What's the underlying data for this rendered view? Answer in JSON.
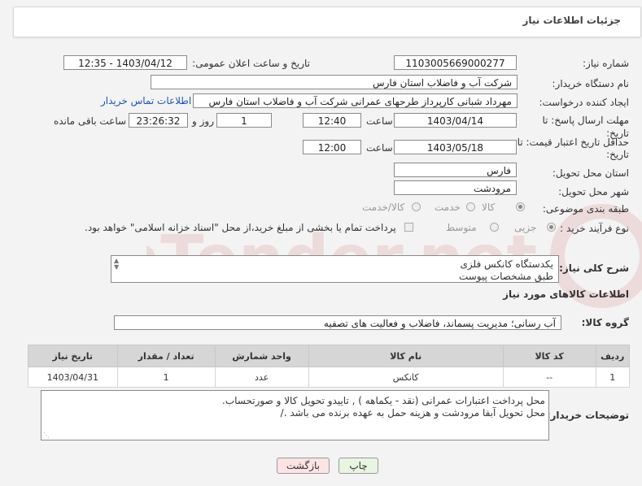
{
  "header": {
    "title": "جزئیات اطلاعات نیاز"
  },
  "form": {
    "need_number_label": "شماره نیاز:",
    "need_number": "1103005669000277",
    "announce_label": "تاریخ و ساعت اعلان عمومی:",
    "announce_value": "1403/04/12 - 12:35",
    "buyer_org_label": "نام دستگاه خریدار:",
    "buyer_org": "شرکت آب و فاضلاب استان فارس",
    "creator_label": "ایجاد کننده درخواست:",
    "creator": "مهرداد شبانی کارپرداز طرحهای عمرانی  شرکت آب و فاضلاب استان فارس",
    "contact_link": "اطلاعات تماس خریدار",
    "deadline_label": "مهلت ارسال پاسخ: تا",
    "deadline_label2": "تاریخ:",
    "deadline_date": "1403/04/14",
    "time_label": "ساعت",
    "deadline_time": "12:40",
    "days_value": "1",
    "days_label": "روز و",
    "remaining_time": "23:26:32",
    "remaining_label": "ساعت باقی مانده",
    "min_validity_label": "حداقل تاریخ اعتبار قیمت: تا",
    "min_validity_label2": "تاریخ:",
    "validity_date": "1403/05/18",
    "validity_time_label": "ساعت",
    "validity_time": "12:00",
    "province_label": "استان محل تحویل:",
    "province": "فارس",
    "city_label": "شهر محل تحویل:",
    "city": "مرودشت",
    "category_label": "طبقه بندی موضوعی:",
    "category_options": [
      "کالا",
      "خدمت",
      "کالا/خدمت"
    ],
    "process_label": "نوع فرآیند خرید :",
    "process_options": [
      "جزیی",
      "متوسط"
    ],
    "payment_note": "پرداخت تمام یا بخشی از مبلغ خرید،از محل \"اسناد خزانه اسلامی\" خواهد بود.",
    "description_label": "شرح کلی نیاز:",
    "description_lines": [
      "یکدستگاه  کانکس فلزی",
      "طبق مشخصات پیوست"
    ]
  },
  "goods": {
    "section_title": "اطلاعات کالاهای مورد نیاز",
    "group_label": "گروه کالا:",
    "group_value": "آب رسانی؛ مدیریت پسماند، فاضلاب و فعالیت های تصفیه",
    "columns": [
      "ردیف",
      "کد کالا",
      "نام کالا",
      "واحد شمارش",
      "تعداد / مقدار",
      "تاریخ نیاز"
    ],
    "rows": [
      {
        "row": "1",
        "code": "--",
        "name": "کانکس",
        "unit": "عدد",
        "qty": "1",
        "date": "1403/04/31"
      }
    ]
  },
  "buyer_notes": {
    "label": "توضیحات خریدار:",
    "lines": [
      "محل پرداخت اعتبارات عمرانی (نقد - یکماهه ) , تاییدو تحویل کالا و صورتحساب.",
      "محل تحویل آبفا مرودشت   و هزینه حمل به عهده برنده می باشد ./"
    ]
  },
  "buttons": {
    "print": "چاپ",
    "back": "بازگشت"
  },
  "watermark": {
    "text": "AriaTender.net"
  },
  "colors": {
    "link": "#1a57b8",
    "back_button_bg": "#fde3e3",
    "print_button_bg": "#e8f5e0",
    "watermark": "#c0392b"
  }
}
